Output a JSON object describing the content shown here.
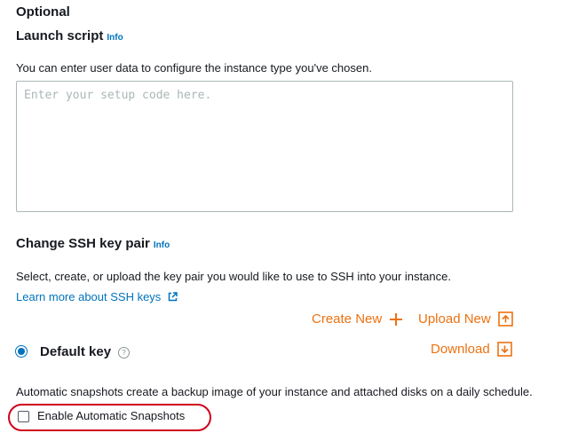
{
  "optional": {
    "title": "Optional"
  },
  "launch_script": {
    "heading": "Launch script",
    "info": "Info",
    "description": "You can enter user data to configure the instance type you've chosen.",
    "placeholder": "Enter your setup code here.",
    "value": ""
  },
  "ssh": {
    "heading": "Change SSH key pair",
    "info": "Info",
    "description": "Select, create, or upload the key pair you would like to use to SSH into your instance.",
    "learn_more": "Learn more about SSH keys",
    "create_new": "Create New",
    "upload_new": "Upload New",
    "download": "Download",
    "default_key": "Default key",
    "default_key_selected": true
  },
  "snapshots": {
    "description": "Automatic snapshots create a backup image of your instance and attached disks on a daily schedule.",
    "checkbox_label": "Enable Automatic Snapshots",
    "checked": false
  },
  "colors": {
    "link": "#0073bb",
    "action": "#ec7211",
    "highlight": "#d0021b",
    "text": "#16191f"
  },
  "icons": {
    "external_link": "external-link-icon",
    "plus": "plus-icon",
    "upload": "upload-icon",
    "download": "download-icon",
    "help": "help-icon"
  }
}
